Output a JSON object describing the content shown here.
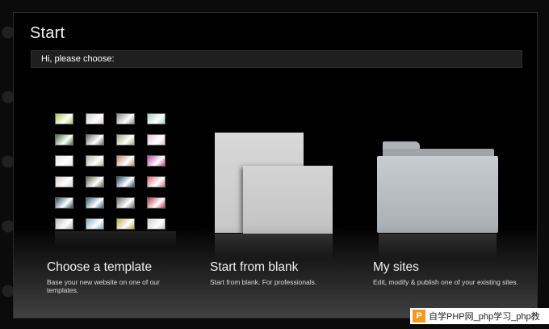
{
  "window": {
    "title": "Start"
  },
  "prompt": "Hi, please choose:",
  "options": [
    {
      "title": "Choose a template",
      "description": "Base your new website on one of our templates."
    },
    {
      "title": "Start from blank",
      "description": "Start from blank. For professionals."
    },
    {
      "title": "My sites",
      "description": "Edit, modify & publish one of your existing sites."
    }
  ],
  "templates": {
    "count": 24,
    "colors": [
      "#a6c84a",
      "#d8c7cf",
      "#8a8a8a",
      "#9dd5c8",
      "#4a6b3f",
      "#6b6b6b",
      "#a7a37b",
      "#e6c3d8",
      "#e8e3dc",
      "#b7b39a",
      "#c08a65",
      "#c6459b",
      "#d9cfc6",
      "#5a6b53",
      "#2a4e7a",
      "#e26a7a",
      "#2d4c6a",
      "#38607b",
      "#6d6d6d",
      "#b93a4c",
      "#b8b8b8",
      "#86aec3",
      "#b9b04a",
      "#cfcfcf"
    ]
  },
  "watermark": {
    "logo": "P",
    "text": "自学PHP网_php学习_php教"
  }
}
